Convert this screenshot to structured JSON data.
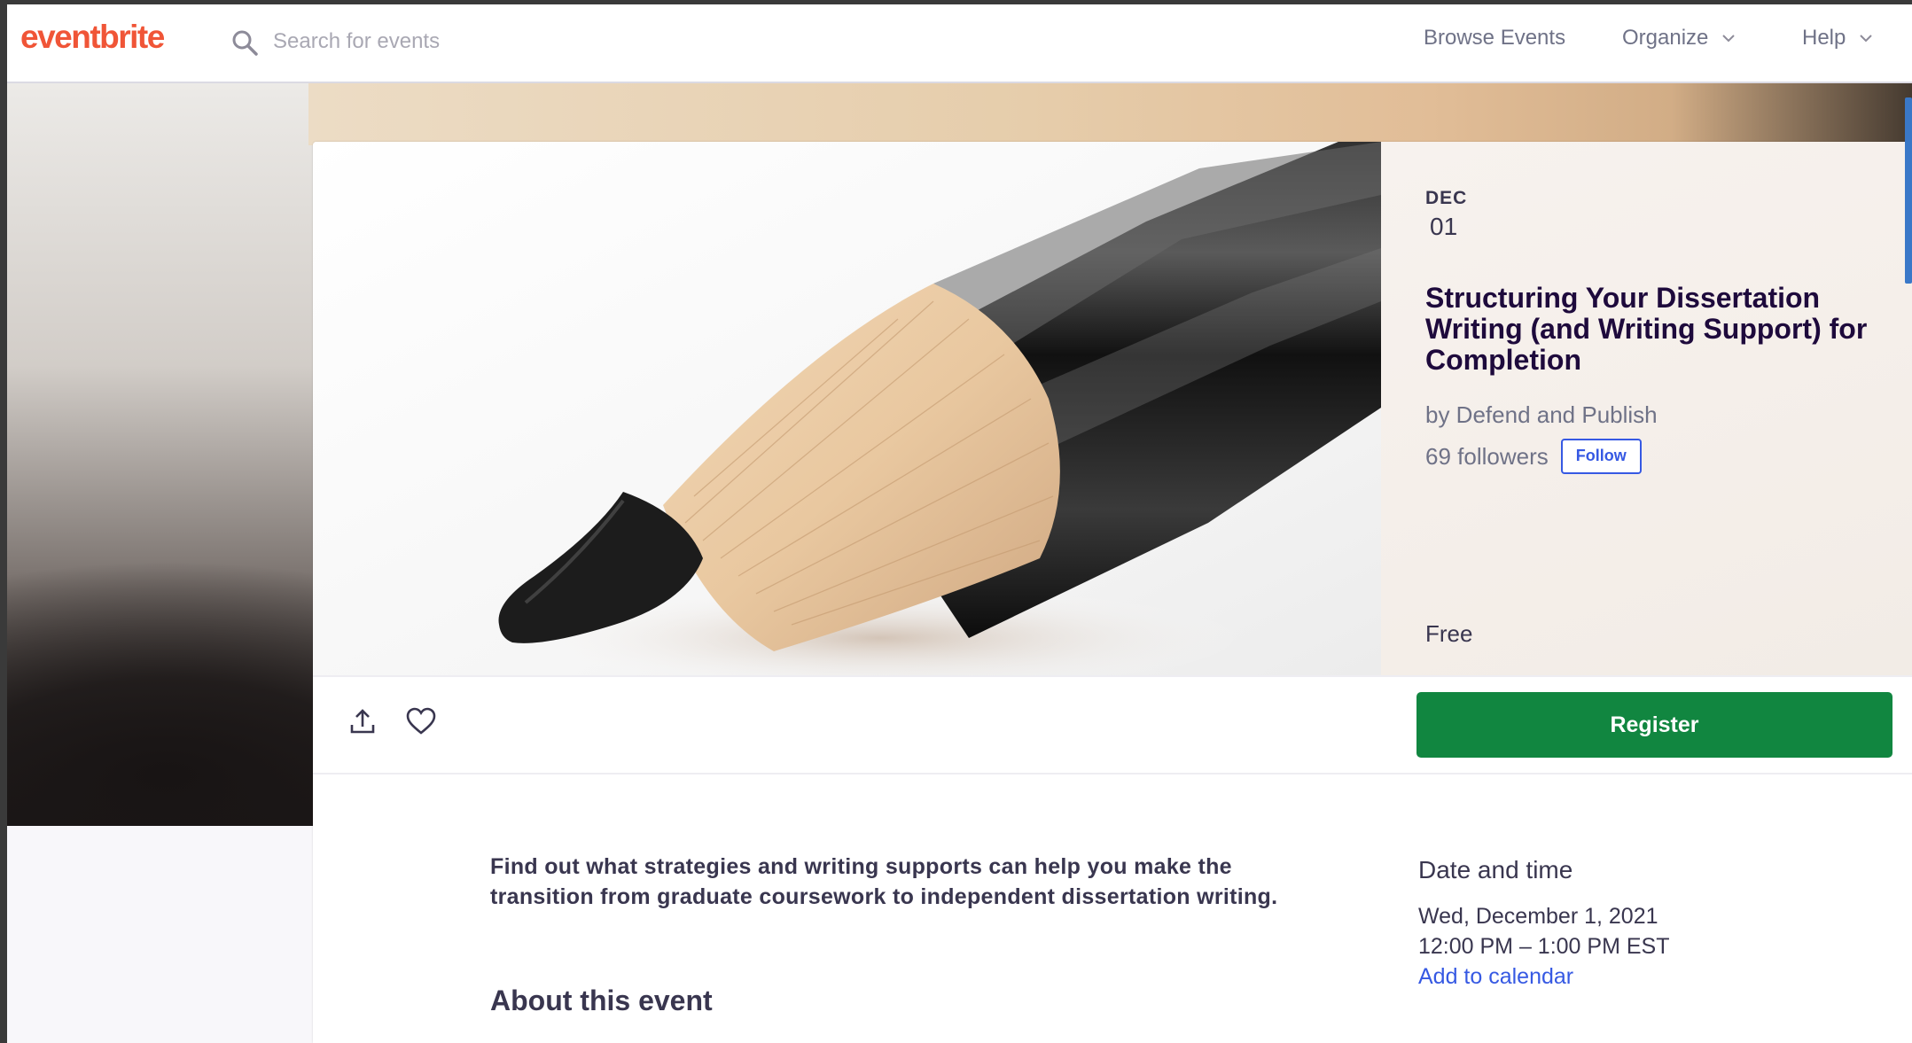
{
  "header": {
    "logo": "eventbrite",
    "search_placeholder": "Search for events",
    "nav": {
      "browse": "Browse Events",
      "organize": "Organize",
      "help": "Help"
    }
  },
  "event": {
    "month": "DEC",
    "day": "01",
    "title": "Structuring Your Dissertation Writing (and Writing Support) for Completion",
    "organizer": "by Defend and Publish",
    "followers": "69 followers",
    "follow_label": "Follow",
    "price": "Free",
    "register_label": "Register",
    "summary": "Find out what strategies and writing supports can help you make the transition from graduate coursework to independent dissertation writing.",
    "about_heading": "About this event"
  },
  "date_time": {
    "heading": "Date and time",
    "date": "Wed, December 1, 2021",
    "time": "12:00 PM – 1:00 PM EST",
    "add_to_calendar": "Add to calendar"
  },
  "colors": {
    "brand": "#f05537",
    "register": "#118640",
    "link": "#3659e3",
    "text": "#39364f"
  },
  "icons": [
    "search-icon",
    "chevron-down-icon",
    "share-icon",
    "heart-icon"
  ]
}
